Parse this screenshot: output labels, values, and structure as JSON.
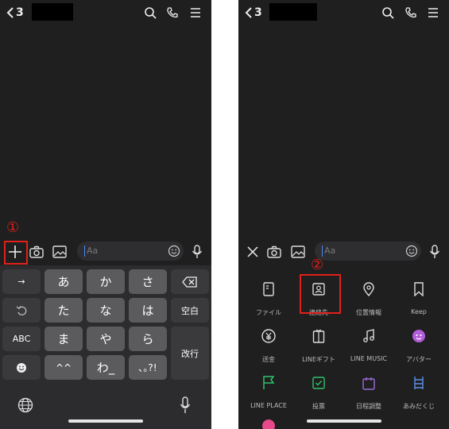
{
  "left": {
    "back_count": "3",
    "input_placeholder": "Aa",
    "keys": {
      "row1": [
        "→",
        "あ",
        "か",
        "さ"
      ],
      "row2": [
        "た",
        "な",
        "は",
        "空白"
      ],
      "row3": [
        "ABC",
        "ま",
        "や",
        "ら",
        "改行"
      ],
      "row4": [
        "^^",
        "わ_",
        "､｡?!"
      ]
    },
    "step_marker": "①"
  },
  "right": {
    "back_count": "3",
    "input_placeholder": "Aa",
    "menu": [
      {
        "label": "ファイル",
        "icon": "file-icon"
      },
      {
        "label": "連絡先",
        "icon": "contact-icon"
      },
      {
        "label": "位置情報",
        "icon": "location-pin-icon"
      },
      {
        "label": "Keep",
        "icon": "bookmark-icon"
      },
      {
        "label": "送金",
        "icon": "yen-icon"
      },
      {
        "label": "LINEギフト",
        "icon": "gift-icon"
      },
      {
        "label": "LINE MUSIC",
        "icon": "music-note-icon"
      },
      {
        "label": "アバター",
        "icon": "avatar-icon"
      },
      {
        "label": "LINE PLACE",
        "icon": "flag-icon"
      },
      {
        "label": "投票",
        "icon": "vote-icon"
      },
      {
        "label": "日程調整",
        "icon": "calendar-icon"
      },
      {
        "label": "あみだくじ",
        "icon": "ladder-icon"
      }
    ],
    "step_marker": "②"
  },
  "colors": {
    "accent_red": "#e0201b",
    "cursor_blue": "#4a86ff",
    "flag_green": "#2ec16b",
    "calendar_purple": "#9b6bd9",
    "ladder_blue": "#5b8fea",
    "avatar_purple": "#b35dd9"
  }
}
